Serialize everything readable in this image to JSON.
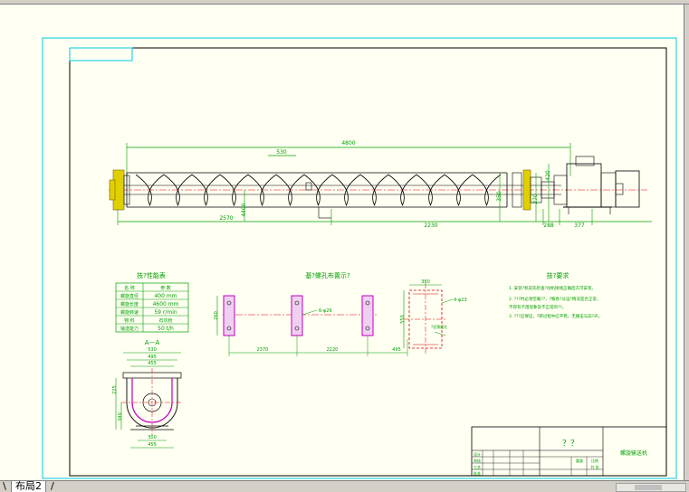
{
  "tabs": {
    "layout2": "布局2",
    "end_mark": "/"
  },
  "colors": {
    "paper": "#fffff2",
    "frame_cyan": "#00c8e6",
    "green": "#00a000",
    "red": "#e00000",
    "magenta": "#c000c0",
    "yellow": "#e0d000"
  },
  "main_view": {
    "overall_length": "4800",
    "pitch": "530",
    "seg_left": "2570",
    "seg_right": "2230",
    "dim_a": "288",
    "dim_b": "377",
    "height_left": "4400",
    "height_right_a": "350",
    "height_right_b": "270",
    "height_right_c": "420"
  },
  "tech_table": {
    "title": "技?性能表",
    "header": [
      "名 称",
      "参 数"
    ],
    "rows": [
      [
        "螺旋直径",
        "400 mm"
      ],
      [
        "螺旋长度",
        "4600 mm"
      ],
      [
        "螺旋转速",
        "59 r/min"
      ],
      [
        "物  料",
        "石灰粉"
      ],
      [
        "输送能力",
        "50 t/h"
      ]
    ]
  },
  "section_view": {
    "title": "A－A",
    "dim_top1": "530",
    "dim_top2": "495",
    "dim_top3": "455",
    "dim_left1": "225",
    "dim_left2": "340",
    "dim_bottom1": "300",
    "dim_bottom2": "455"
  },
  "foundation_plan": {
    "title": "基?螺孔布置示?",
    "dim_1": "2370",
    "dim_2": "2220",
    "dim_3": "495",
    "height": "260",
    "hole_note": "6-φ26"
  },
  "detail_view": {
    "width": "380",
    "height": "550",
    "hole_note": "4-φ23",
    "note": "?泥预留孔"
  },
  "requirements": {
    "title": "技?要求",
    "items": [
      "1. 安装?机前先检查?动机接线正确后方可安装。",
      "2. ???时必须空载??，?察各?分运?情况是否正常，",
      "   不得有卡阻现象及不正常的??。",
      "3. ???应保证，?转过程中应平稳，无撞击与异?声。"
    ]
  },
  "title_block": {
    "drawing_name": "？？",
    "product_name": "螺旋输送机",
    "row_labels": [
      "设计",
      "审核",
      "工艺",
      "批准"
    ],
    "scale_label": "比例",
    "weight_label": "重量",
    "sheet_label": "共 张"
  }
}
